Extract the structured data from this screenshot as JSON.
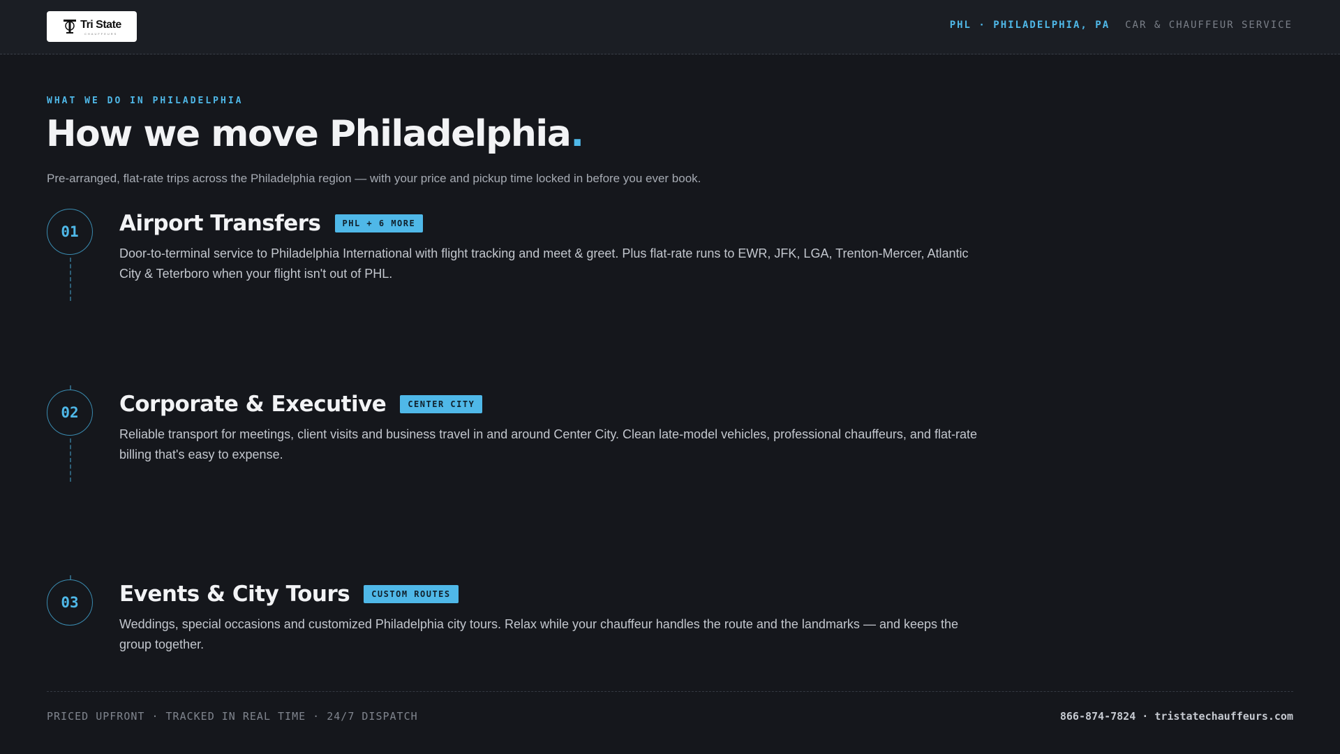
{
  "header": {
    "logo_text": "Tri State",
    "logo_subtext": "CHAUFFEURS",
    "location": "PHL · PHILADELPHIA, PA",
    "service_type": "CAR & CHAUFFEUR SERVICE"
  },
  "hero": {
    "eyebrow": "WHAT WE DO IN PHILADELPHIA",
    "headline": "How we move Philadelphia",
    "headline_dot": ".",
    "intro": "Pre-arranged, flat-rate trips across the Philadelphia region — with your price and pickup time locked in before you ever book."
  },
  "services": [
    {
      "number": "01",
      "title": "Airport Transfers",
      "tag": "PHL + 6 MORE",
      "description": "Door-to-terminal service to Philadelphia International with flight tracking and meet & greet. Plus flat-rate runs to EWR, JFK, LGA, Trenton-Mercer, Atlantic City & Teterboro when your flight isn't out of PHL."
    },
    {
      "number": "02",
      "title": "Corporate & Executive",
      "tag": "CENTER CITY",
      "description": "Reliable transport for meetings, client visits and business travel in and around Center City. Clean late-model vehicles, professional chauffeurs, and flat-rate billing that's easy to expense."
    },
    {
      "number": "03",
      "title": "Events & City Tours",
      "tag": "CUSTOM ROUTES",
      "description": "Weddings, special occasions and customized Philadelphia city tours. Relax while your chauffeur handles the route and the landmarks — and keeps the group together."
    }
  ],
  "footer": {
    "features": "PRICED UPFRONT · TRACKED IN REAL TIME · 24/7 DISPATCH",
    "contact": "866-874-7824 · tristatechauffeurs.com"
  },
  "colors": {
    "accent": "#4fb8e8",
    "background": "#15171c",
    "topbar": "#1b1e24"
  }
}
